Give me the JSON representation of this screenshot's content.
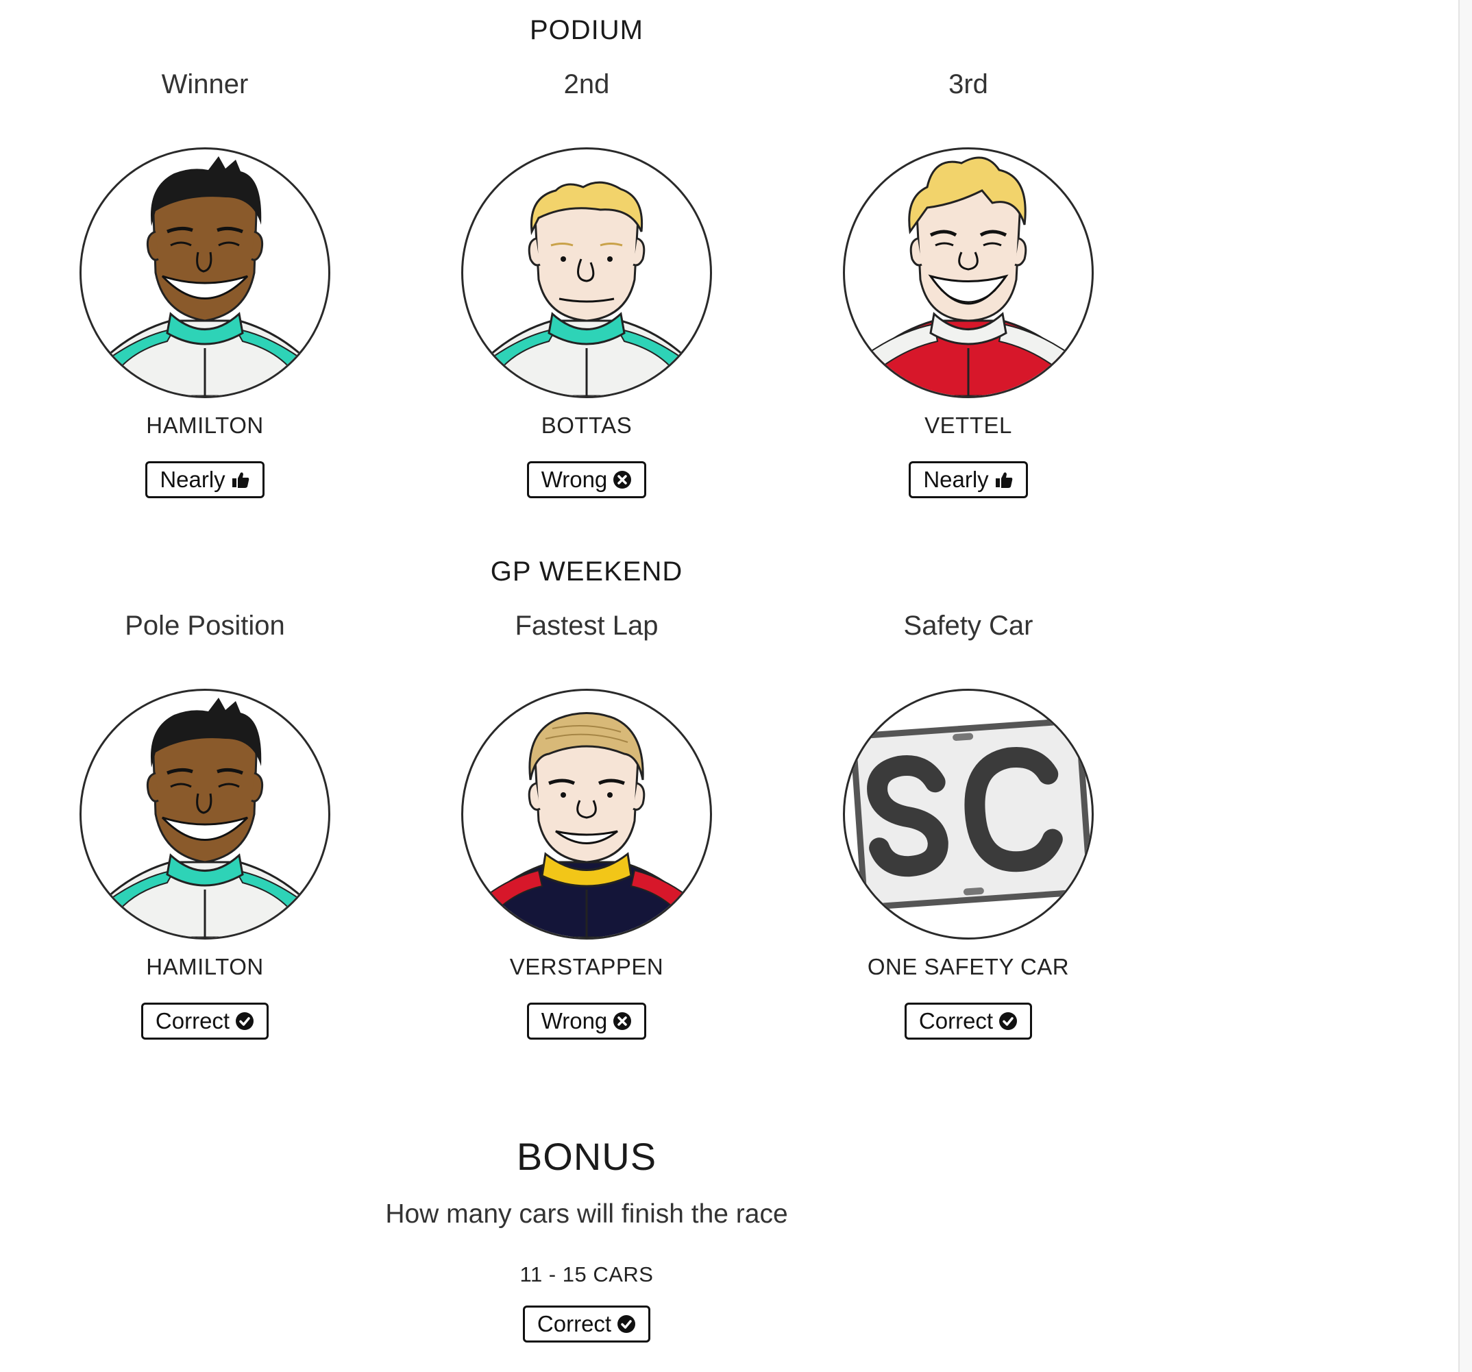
{
  "podium": {
    "title": "PODIUM",
    "cells": [
      {
        "label": "Winner",
        "pick": "HAMILTON",
        "result": "Nearly",
        "result_icon": "thumbs-up-icon",
        "avatar": "hamilton"
      },
      {
        "label": "2nd",
        "pick": "BOTTAS",
        "result": "Wrong",
        "result_icon": "cross-circle-icon",
        "avatar": "bottas"
      },
      {
        "label": "3rd",
        "pick": "VETTEL",
        "result": "Nearly",
        "result_icon": "thumbs-up-icon",
        "avatar": "vettel"
      }
    ]
  },
  "weekend": {
    "title": "GP WEEKEND",
    "cells": [
      {
        "label": "Pole Position",
        "pick": "HAMILTON",
        "result": "Correct",
        "result_icon": "check-circle-icon",
        "avatar": "hamilton"
      },
      {
        "label": "Fastest Lap",
        "pick": "VERSTAPPEN",
        "result": "Wrong",
        "result_icon": "cross-circle-icon",
        "avatar": "verstappen"
      },
      {
        "label": "Safety Car",
        "pick": "ONE SAFETY CAR",
        "result": "Correct",
        "result_icon": "check-circle-icon",
        "avatar": "safety-car"
      }
    ]
  },
  "bonus": {
    "title": "BONUS",
    "question": "How many cars will finish the race",
    "answer": "11 - 15 CARS",
    "result": "Correct",
    "result_icon": "check-circle-icon"
  },
  "colors": {
    "mercedes_teal": "#2ed3b7",
    "ferrari_red": "#d7172a",
    "redbull_navy": "#141539",
    "redbull_yellow": "#f2c618",
    "skin_dark": "#8a5a2b",
    "skin_light": "#f6e4d6",
    "hair_blond": "#f2d36b"
  }
}
